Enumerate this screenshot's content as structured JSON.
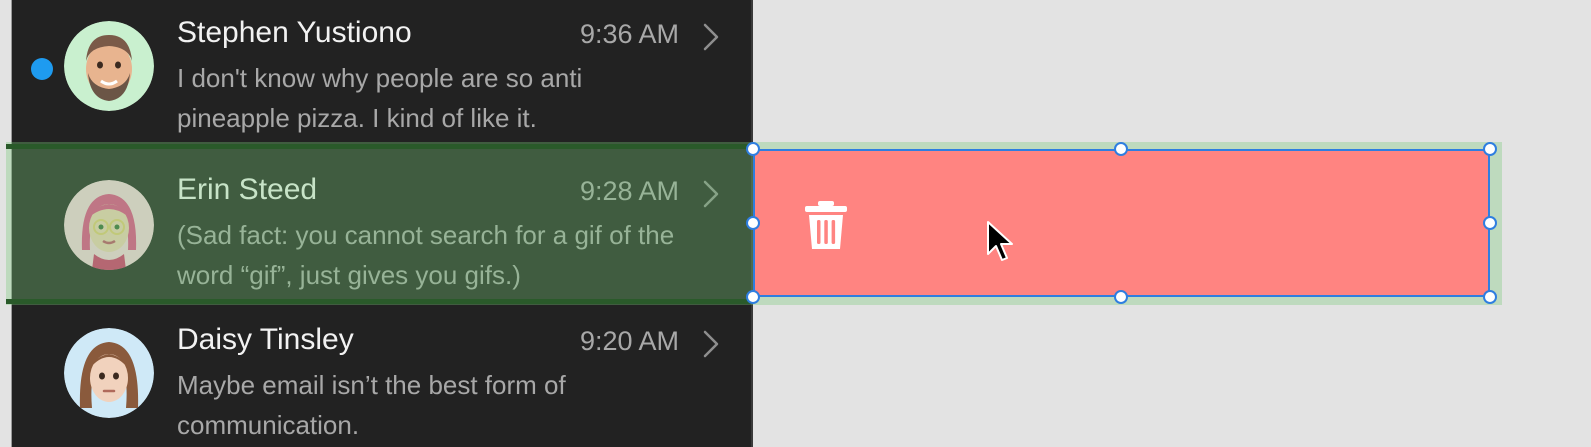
{
  "messages": [
    {
      "name": "Stephen Yustiono",
      "time": "9:36 AM",
      "preview": "I don't know why people are so anti pineapple pizza. I kind of like it.",
      "unread": true,
      "avatar_icon": "memoji-man-beard-icon",
      "avatar_bg": "#c9f0cf"
    },
    {
      "name": "Erin Steed",
      "time": "9:28 AM",
      "preview": "(Sad fact: you cannot search for a gif of the word “gif”, just gives you gifs.)",
      "unread": false,
      "avatar_icon": "memoji-woman-pink-hair-icon",
      "avatar_bg": "#fbd3e2"
    },
    {
      "name": "Daisy Tinsley",
      "time": "9:20 AM",
      "preview": "Maybe email isn’t the best form of communication.",
      "unread": false,
      "avatar_icon": "memoji-woman-brown-hair-icon",
      "avatar_bg": "#cfe9f7"
    }
  ],
  "delete_action": {
    "icon": "trash-icon",
    "color": "#ff8481"
  },
  "colors": {
    "list_bg": "#222222",
    "unread_dot": "#1e9bf0",
    "selection_outline": "#2f7ee0",
    "canvas_bg": "#e3e3e3"
  }
}
